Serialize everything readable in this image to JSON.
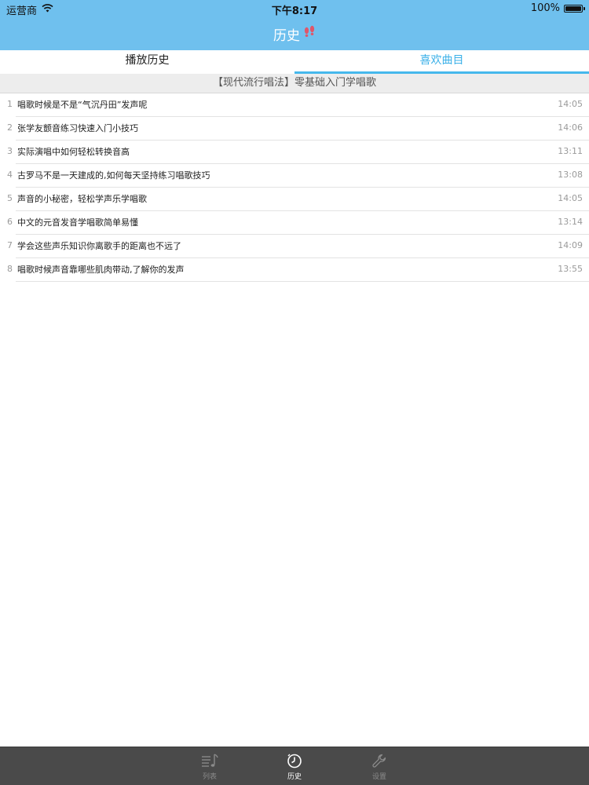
{
  "status_bar": {
    "carrier": "运营商",
    "time": "下午8:17",
    "battery": "100%",
    "battery_level": 1.0
  },
  "nav": {
    "title": "历史"
  },
  "tabs": [
    {
      "label": "播放历史",
      "active": false
    },
    {
      "label": "喜欢曲目",
      "active": true
    }
  ],
  "album": {
    "title": "【现代流行唱法】零基础入门学唱歌"
  },
  "songs": [
    {
      "index": "1",
      "title": "唱歌时候是不是“气沉丹田”发声呢",
      "time": "14:05"
    },
    {
      "index": "2",
      "title": "张学友颤音练习快速入门小技巧",
      "time": "14:06"
    },
    {
      "index": "3",
      "title": "实际演唱中如何轻松转换音高",
      "time": "13:11"
    },
    {
      "index": "4",
      "title": "古罗马不是一天建成的,如何每天坚持练习唱歌技巧",
      "time": "13:08"
    },
    {
      "index": "5",
      "title": "声音的小秘密，轻松学声乐学唱歌",
      "time": "14:05"
    },
    {
      "index": "6",
      "title": "中文的元音发音学唱歌简单易懂",
      "time": "13:14"
    },
    {
      "index": "7",
      "title": "学会这些声乐知识你离歌手的距离也不远了",
      "time": "14:09"
    },
    {
      "index": "8",
      "title": "唱歌时候声音靠哪些肌肉带动,了解你的发声",
      "time": "13:55"
    }
  ],
  "tabbar": {
    "items": [
      {
        "label": "列表",
        "icon": "music-list-icon",
        "active": false
      },
      {
        "label": "历史",
        "icon": "clock-icon",
        "active": true
      },
      {
        "label": "设置",
        "icon": "wrench-icon",
        "active": false
      }
    ]
  },
  "colors": {
    "header": "#6fc0ee",
    "accent": "#3ab0e8",
    "tabbar": "#4a4a4a"
  }
}
